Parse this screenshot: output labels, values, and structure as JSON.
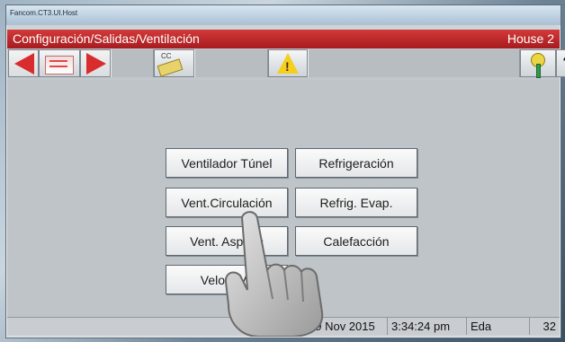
{
  "window": {
    "title": "Fancom.CT3.UI.Host"
  },
  "header": {
    "path": "Configuración/Salidas/Ventilación",
    "house": "House 2"
  },
  "toolbar": {
    "cc_label": "CC",
    "help_label": "?"
  },
  "menu": {
    "buttons": [
      {
        "label": "Ventilador Túnel"
      },
      {
        "label": "Refrigeración"
      },
      {
        "label": "Vent.Circulación"
      },
      {
        "label": "Refrig. Evap."
      },
      {
        "label": "Vent. Aspirac"
      },
      {
        "label": "Calefacción"
      },
      {
        "label": "Veloc. Ve"
      }
    ]
  },
  "status": {
    "date": "19 Nov 2015",
    "time": "3:34:24 pm",
    "label": "Eda",
    "value": "32"
  }
}
